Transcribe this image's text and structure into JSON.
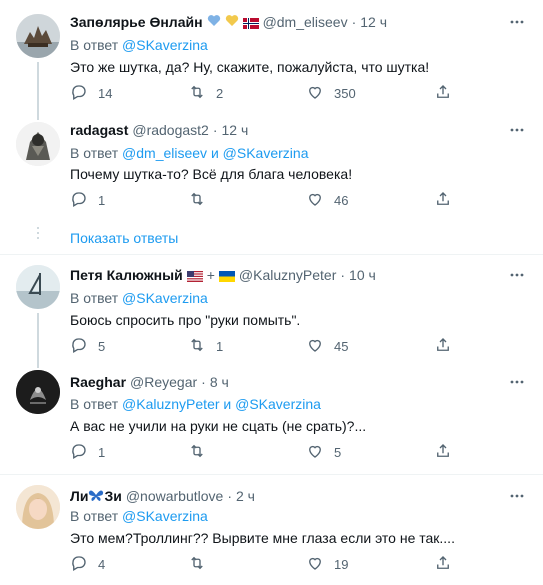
{
  "tweets": [
    {
      "name": "Запөлярье Өнлайн",
      "handle": "@dm_eliseev",
      "time": "12 ч",
      "reply_prefix": "В ответ",
      "reply_to": "@SKaverzina",
      "reply_and": "",
      "reply_to2": "",
      "text": "Это же шутка, да? Ну, скажите, пожалуйста, что шутка!",
      "replies": "14",
      "retweets": "2",
      "likes": "350"
    },
    {
      "name": "radagast",
      "handle": "@radogast2",
      "time": "12 ч",
      "reply_prefix": "В ответ",
      "reply_to": "@dm_eliseev",
      "reply_and": "и",
      "reply_to2": "@SKaverzina",
      "text": "Почему шутка-то? Всё для блага человека!",
      "replies": "1",
      "retweets": "",
      "likes": "46"
    },
    {
      "name": "Петя Калюжный",
      "handle": "@KaluznyPeter",
      "time": "10 ч",
      "reply_prefix": "В ответ",
      "reply_to": "@SKaverzina",
      "reply_and": "",
      "reply_to2": "",
      "text": "Боюсь спросить про \"руки помыть\".",
      "replies": "5",
      "retweets": "1",
      "likes": "45"
    },
    {
      "name": "Raeghar",
      "handle": "@Reyegar",
      "time": "8 ч",
      "reply_prefix": "В ответ",
      "reply_to": "@KaluznyPeter",
      "reply_and": "и",
      "reply_to2": "@SKaverzina",
      "text": "А вас не учили на руки не сцать (не срать)?...",
      "replies": "1",
      "retweets": "",
      "likes": "5"
    },
    {
      "name_a": "Ли",
      "name_b": "Зи",
      "handle": "@nowarbutlove",
      "time": "2 ч",
      "reply_prefix": "В ответ",
      "reply_to": "@SKaverzina",
      "reply_and": "",
      "reply_to2": "",
      "text": "Это мем?Троллинг?? Вырвите мне глаза если это не так....",
      "replies": "4",
      "retweets": "",
      "likes": "19"
    }
  ],
  "show_replies": "Показать ответы",
  "separator_dot": "·",
  "plus_sign": "+",
  "colors": {
    "accent": "#1d9bf0",
    "muted": "#536471",
    "line": "#cfd9de"
  },
  "icons": [
    "reply-icon",
    "retweet-icon",
    "like-icon",
    "share-icon",
    "more-icon"
  ]
}
